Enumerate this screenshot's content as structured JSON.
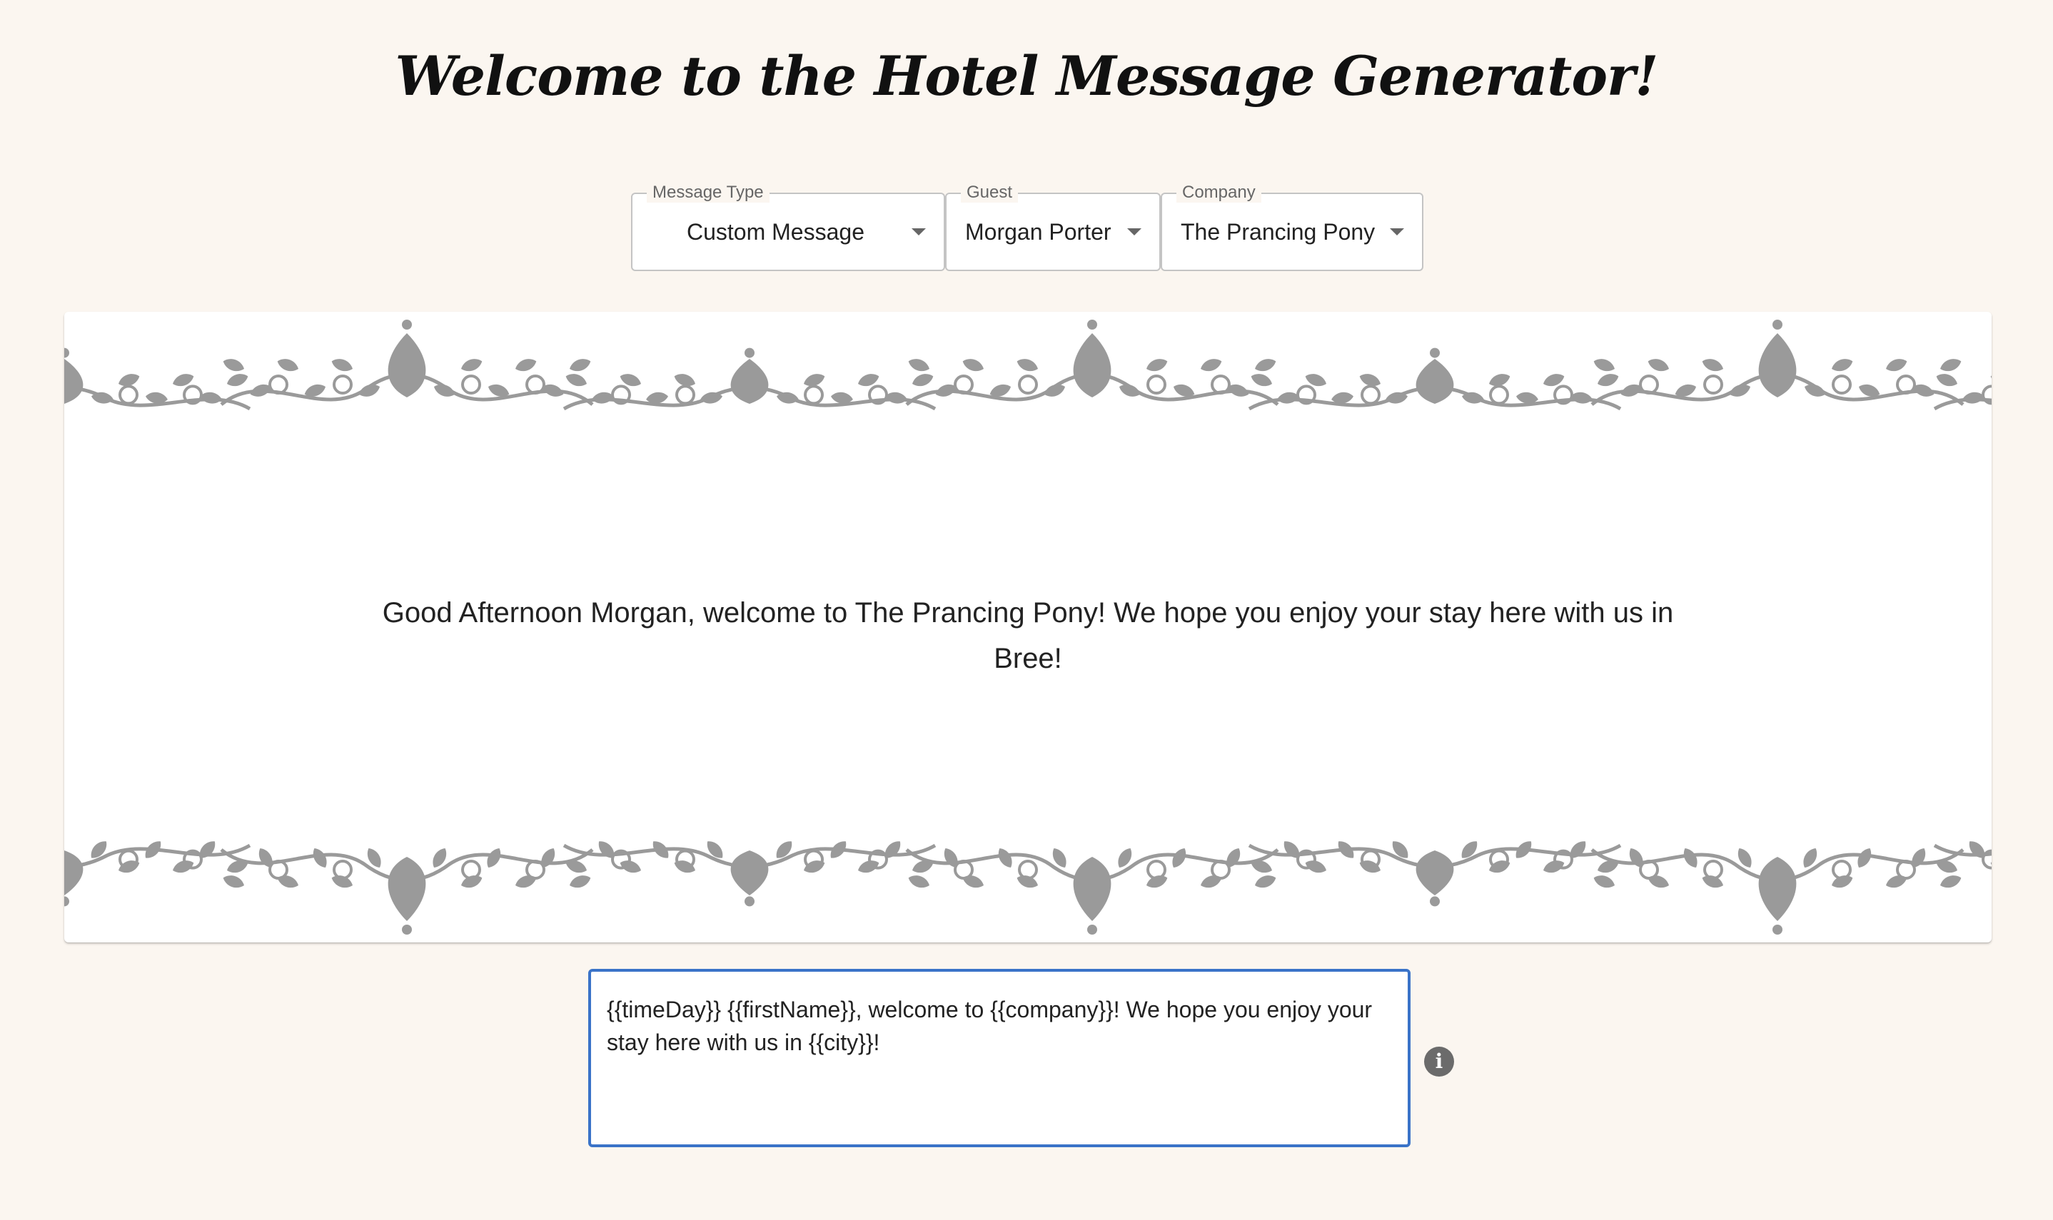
{
  "page": {
    "title": "Welcome to the Hotel Message Generator!"
  },
  "selects": {
    "message_type": {
      "label": "Message Type",
      "value": "Custom Message",
      "icon": "caret-down-icon"
    },
    "guest": {
      "label": "Guest",
      "value": "Morgan Porter",
      "icon": "caret-down-icon"
    },
    "company": {
      "label": "Company",
      "value": "The Prancing Pony",
      "icon": "caret-down-icon"
    }
  },
  "preview": {
    "message": "Good Afternoon Morgan, welcome to The Prancing Pony! We hope you enjoy your stay here with us in Bree!"
  },
  "editor": {
    "template": "{{timeDay}} {{firstName}}, welcome to {{company}}! We hope you enjoy your stay here with us in {{city}}!"
  },
  "info": {
    "icon": "info-icon",
    "glyph": "i"
  },
  "colors": {
    "background": "#fbf6f0",
    "accent": "#3a73c8",
    "ornament": "#9a9a9a"
  }
}
